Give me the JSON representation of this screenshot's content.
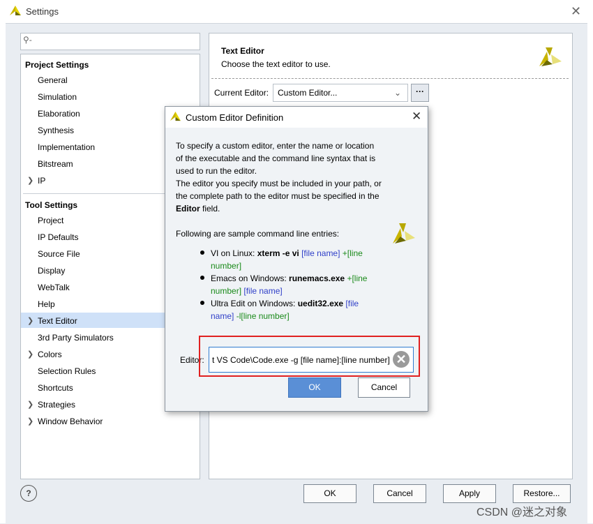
{
  "window": {
    "title": "Settings"
  },
  "search": {
    "placeholder": ""
  },
  "project_settings": {
    "header": "Project Settings",
    "items": [
      "General",
      "Simulation",
      "Elaboration",
      "Synthesis",
      "Implementation",
      "Bitstream",
      "IP"
    ]
  },
  "tool_settings": {
    "header": "Tool Settings",
    "items": [
      "Project",
      "IP Defaults",
      "Source File",
      "Display",
      "WebTalk",
      "Help",
      "Text Editor",
      "3rd Party Simulators",
      "Colors",
      "Selection Rules",
      "Shortcuts",
      "Strategies",
      "Window Behavior"
    ]
  },
  "right_panel": {
    "title": "Text Editor",
    "subtitle": "Choose the text editor to use.",
    "current_editor_label": "Current Editor:",
    "current_editor_value": "Custom Editor...",
    "browse_label": "···"
  },
  "footer": {
    "ok": "OK",
    "cancel": "Cancel",
    "apply": "Apply",
    "restore": "Restore..."
  },
  "dialog": {
    "title": "Custom Editor Definition",
    "para1_l1": "To specify a custom editor, enter the name or location",
    "para1_l2": "of the executable and the command line syntax that is",
    "para1_l3": "used to run the editor.",
    "para2_l1": "The editor you specify must be included in your path, or",
    "para2_l2": "the complete path to the editor must be specified in the",
    "para2_l3a": "Editor",
    "para2_l3b": " field.",
    "samples_intro": "Following are sample command line entries:",
    "b1_a": "VI on Linux: ",
    "b1_b": "xterm -e vi",
    "b1_c": " [file name]",
    "b1_d": " +[line",
    "b1_e": "number]",
    "b2_a": "Emacs on Windows: ",
    "b2_b": "runemacs.exe",
    "b2_c": " +[line",
    "b2_d": "number]",
    "b2_e": " [file name]",
    "b3_a": "Ultra Edit on Windows: ",
    "b3_b": "uedit32.exe",
    "b3_c": " [file",
    "b3_d": "name]",
    "b3_e": " -l[line number]",
    "editor_label": "Editor:",
    "editor_value": "t VS Code\\Code.exe -g [file name]:[line number]",
    "ok": "OK",
    "cancel": "Cancel"
  },
  "watermark": "CSDN @迷之对象",
  "colors": {
    "accent": "#5a8fd6",
    "highlight": "#e02020",
    "selection": "#cfe1f8"
  }
}
